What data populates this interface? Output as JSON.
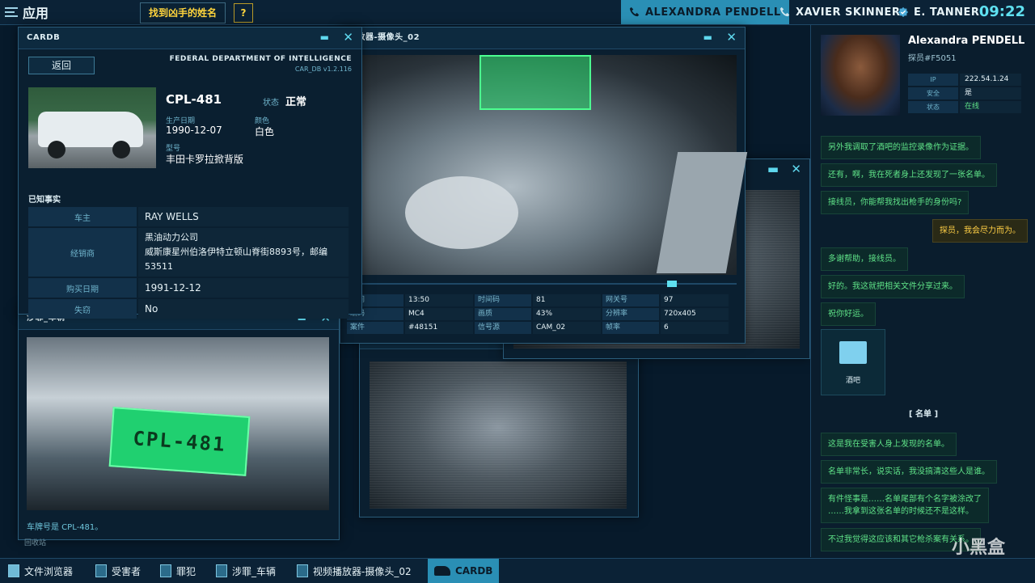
{
  "topbar": {
    "app_label": "应用",
    "objective": "找到凶手的姓名",
    "help": "?",
    "contacts": [
      {
        "name": "ALEXANDRA PENDELL",
        "icon": "phone-icon",
        "active": true
      },
      {
        "name": "XAVIER SKINNER",
        "icon": "phone-icon",
        "active": false
      },
      {
        "name": "E. TANNER",
        "icon": "verified-badge-icon",
        "active": false
      }
    ],
    "clock": "09:22"
  },
  "cardb": {
    "title": "CARDB",
    "back": "返回",
    "agency": "FEDERAL DEPARTMENT OF INTELLIGENCE",
    "version": "CAR_DB   v1.2.116",
    "plate": "CPL-481",
    "status_label": "状态",
    "status_value": "正常",
    "prod_date_label": "生产日期",
    "prod_date": "1990-12-07",
    "color_label": "颜色",
    "color_value": "白色",
    "model_label": "型号",
    "model_value": "丰田卡罗拉掀背版",
    "facts_label": "已知事实",
    "facts": [
      {
        "key": "车主",
        "value": "RAY WELLS"
      },
      {
        "key": "经销商",
        "value": "黑油动力公司",
        "value2": "威斯康星州伯洛伊特立顿山脊街8893号，邮编",
        "value3": "53511"
      },
      {
        "key": "购买日期",
        "value": "1991-12-12"
      },
      {
        "key": "失窃",
        "value": "No"
      }
    ]
  },
  "player": {
    "title": "视频播放器-摄像头_02",
    "title_visible": "播放器-摄像头_02",
    "meta": [
      {
        "k": "时间",
        "v": "13:50"
      },
      {
        "k": "时间码",
        "v": "81"
      },
      {
        "k": "网关号",
        "v": "97"
      },
      {
        "k": "编码",
        "v": "MC4"
      },
      {
        "k": "画质",
        "v": "43%"
      },
      {
        "k": "分辨率",
        "v": "720x405"
      },
      {
        "k": "案件",
        "v": "#48151"
      },
      {
        "k": "信号源",
        "v": "CAM_02"
      },
      {
        "k": "帧率",
        "v": "6"
      }
    ]
  },
  "vehicle": {
    "title": "涉罪_车辆",
    "plate_text": "CPL-481",
    "caption": "车牌号是 CPL-481。",
    "overflow": "回收站"
  },
  "victim": {
    "title_visible": "受害者"
  },
  "profile": {
    "name": "Alexandra PENDELL",
    "subtitle": "探员#F5051",
    "fields": [
      {
        "k": "IP",
        "v": "222.54.1.24"
      },
      {
        "k": "安全",
        "v": "是"
      },
      {
        "k": "状态",
        "v": "在线"
      }
    ]
  },
  "chat": {
    "messages": [
      {
        "text": "另外我调取了酒吧的监控录像作为证据。",
        "me": false
      },
      {
        "text": "还有，啊，我在死者身上还发现了一张名单。",
        "me": false
      },
      {
        "text": "接线员，你能帮我找出枪手的身份吗?",
        "me": false
      },
      {
        "text": "探员，我会尽力而为。",
        "me": true
      },
      {
        "text": "多谢帮助，接线员。",
        "me": false
      },
      {
        "text": "好的。我这就把相关文件分享过来。",
        "me": false
      },
      {
        "text": "祝你好运。",
        "me": false
      }
    ],
    "folder_label": "酒吧",
    "list_header": "[  名单  ]",
    "messages2": [
      {
        "text": "这是我在受害人身上发现的名单。"
      },
      {
        "text": "名单非常长，说实话，我没搞清这些人是谁。"
      },
      {
        "text": "有件怪事是……名单尾部有个名字被涂改了",
        "text2": "……我拿到这张名单的时候还不是这样。"
      },
      {
        "text": "不过我觉得这应该和其它枪杀案有关系。"
      }
    ]
  },
  "taskbar": {
    "items": [
      "文件浏览器",
      "受害者",
      "罪犯",
      "涉罪_车辆",
      "视频播放器-摄像头_02",
      "CARDB"
    ],
    "active": "CARDB"
  },
  "watermark": "小黑盒"
}
